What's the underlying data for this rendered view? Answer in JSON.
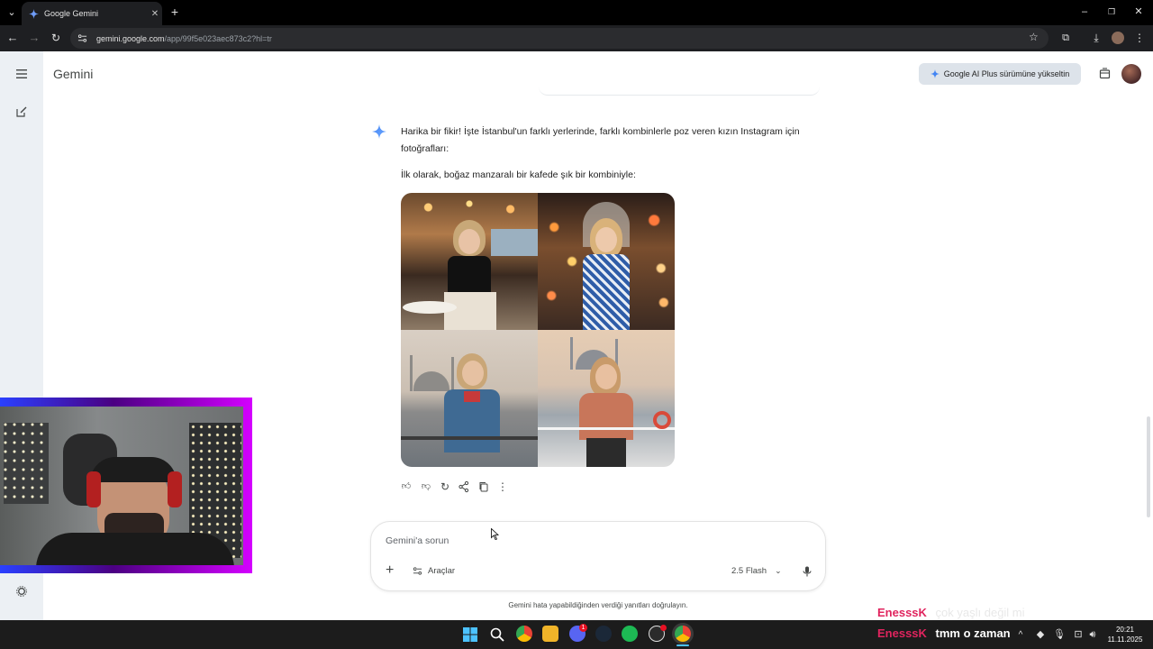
{
  "browser": {
    "tab_title": "Google Gemini",
    "url_host": "gemini.google.com",
    "url_path": "/app/99f5e023aec873c2?hl=tr"
  },
  "app": {
    "title": "Gemini",
    "upgrade_label": "Google AI Plus sürümüne yükseltin"
  },
  "response": {
    "intro": "Harika bir fikir! İşte İstanbul'un farklı yerlerinde, farklı kombinlerle poz veren kızın Instagram için fotoğrafları:",
    "first_line": "İlk olarak, boğaz manzaralı bir kafede şık bir kombiniyle:"
  },
  "input": {
    "placeholder": "Gemini'a sorun",
    "tools_label": "Araçlar",
    "model_label": "2.5 Flash"
  },
  "disclaimer": "Gemini hata yapabildiğinden verdiği yanıtları doğrulayın.",
  "overlay_chat": [
    {
      "user": "EnesssK",
      "message": "çok yaşlı değil mi"
    },
    {
      "user": "EnesssK",
      "message": "tmm o zaman"
    }
  ],
  "taskbar": {
    "time": "20:21",
    "date": "11.11.2025",
    "discord_badge": "1"
  },
  "colors": {
    "gemini_accent": "#4285f4",
    "chat_user": "#e0245e",
    "tab_bg": "#1e1f22"
  }
}
